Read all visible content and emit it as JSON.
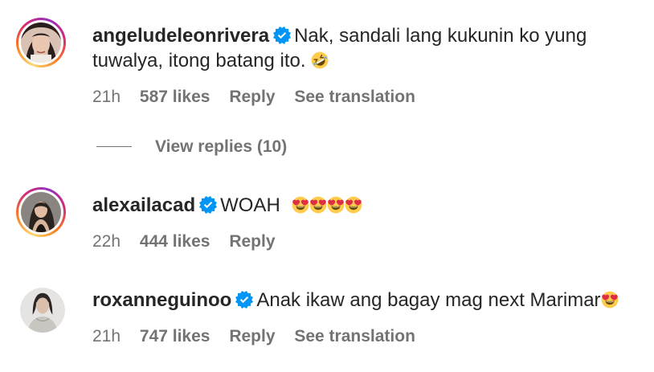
{
  "comments": [
    {
      "username": "angeludeleonrivera",
      "verified": true,
      "text_line1": "Nak, sandali lang kukunin ko yung",
      "text_line2": "tuwalya, itong batang ito.",
      "emoji": "rolling-on-floor-laughing",
      "time": "21h",
      "likes": "587 likes",
      "reply_label": "Reply",
      "translation_label": "See translation"
    },
    {
      "username": "alexailacad",
      "verified": true,
      "text": "WOAH",
      "emoji": "heart-eyes x4",
      "time": "22h",
      "likes": "444 likes",
      "reply_label": "Reply"
    },
    {
      "username": "roxanneguinoo",
      "verified": true,
      "text": "Anak ikaw ang bagay mag next Marimar",
      "emoji": "heart-eyes",
      "time": "21h",
      "likes": "747 likes",
      "reply_label": "Reply",
      "translation_label": "See translation"
    }
  ],
  "view_replies": "View replies (10)",
  "colors": {
    "text": "#262626",
    "secondary": "#737373",
    "verified": "#0095f6"
  }
}
